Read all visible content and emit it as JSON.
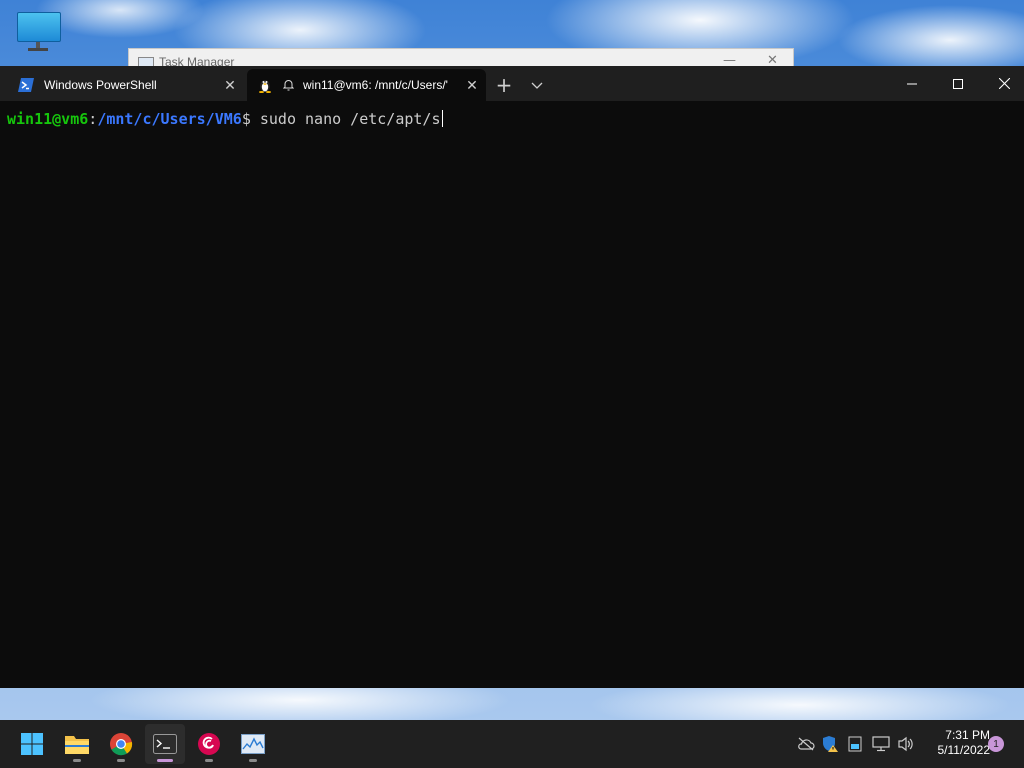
{
  "desktop": {
    "icon_name": "this-pc-icon",
    "background_window_title": "Task Manager"
  },
  "terminal": {
    "tabs": [
      {
        "label": "Windows PowerShell",
        "icon": "powershell-icon",
        "active": false
      },
      {
        "label": "win11@vm6: /mnt/c/Users/'",
        "icon": "linux-tux-icon",
        "active": true
      }
    ],
    "new_tab_label": "+",
    "console": {
      "user_host": "win11@vm6",
      "separator": ":",
      "path": "/mnt/c/Users/VM6",
      "prompt_symbol": "$",
      "command": " sudo nano /etc/apt/s"
    },
    "colors": {
      "user": "#16c60c",
      "path": "#3b78ff",
      "background": "#0c0c0c"
    }
  },
  "taskbar": {
    "apps": [
      {
        "name": "start-icon"
      },
      {
        "name": "file-explorer-icon"
      },
      {
        "name": "chrome-icon"
      },
      {
        "name": "terminal-icon",
        "active": true
      },
      {
        "name": "debian-icon"
      },
      {
        "name": "task-manager-icon"
      }
    ],
    "tray": [
      "cloud-offline-icon",
      "security-warning-icon",
      "storage-icon",
      "network-icon",
      "volume-icon"
    ],
    "time": "7:31 PM",
    "date": "5/11/2022",
    "notifications": "1"
  }
}
